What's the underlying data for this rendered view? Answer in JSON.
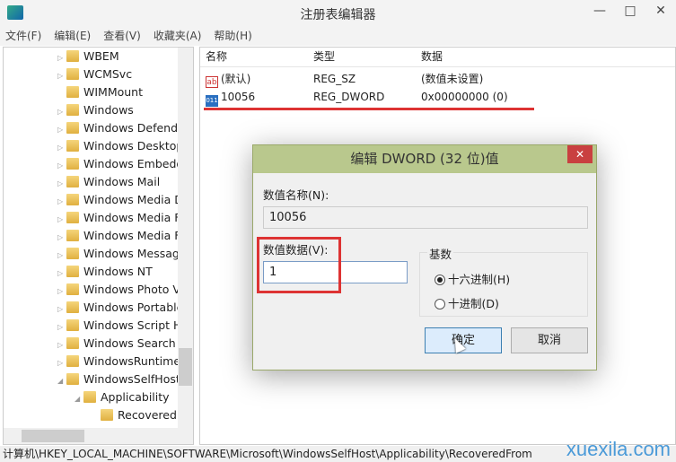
{
  "window": {
    "title": "注册表编辑器",
    "minimize": "—",
    "maximize": "□",
    "close": "✕"
  },
  "menu": [
    "文件(F)",
    "编辑(E)",
    "查看(V)",
    "收藏夹(A)",
    "帮助(H)"
  ],
  "tree": [
    {
      "label": "WBEM",
      "level": 0,
      "exp": "▷"
    },
    {
      "label": "WCMSvc",
      "level": 0,
      "exp": "▷"
    },
    {
      "label": "WIMMount",
      "level": 0,
      "exp": ""
    },
    {
      "label": "Windows",
      "level": 0,
      "exp": "▷"
    },
    {
      "label": "Windows Defende",
      "level": 0,
      "exp": "▷"
    },
    {
      "label": "Windows Desktop",
      "level": 0,
      "exp": "▷"
    },
    {
      "label": "Windows Embedd",
      "level": 0,
      "exp": "▷"
    },
    {
      "label": "Windows Mail",
      "level": 0,
      "exp": "▷"
    },
    {
      "label": "Windows Media D",
      "level": 0,
      "exp": "▷"
    },
    {
      "label": "Windows Media F",
      "level": 0,
      "exp": "▷"
    },
    {
      "label": "Windows Media F",
      "level": 0,
      "exp": "▷"
    },
    {
      "label": "Windows Messag",
      "level": 0,
      "exp": "▷"
    },
    {
      "label": "Windows NT",
      "level": 0,
      "exp": "▷"
    },
    {
      "label": "Windows Photo V",
      "level": 0,
      "exp": "▷"
    },
    {
      "label": "Windows Portable",
      "level": 0,
      "exp": "▷"
    },
    {
      "label": "Windows Script H",
      "level": 0,
      "exp": "▷"
    },
    {
      "label": "Windows Search",
      "level": 0,
      "exp": "▷"
    },
    {
      "label": "WindowsRuntime",
      "level": 0,
      "exp": "▷"
    },
    {
      "label": "WindowsSelfHost",
      "level": 0,
      "exp": "◢"
    },
    {
      "label": "Applicability",
      "level": 1,
      "exp": "◢"
    },
    {
      "label": "RecoveredI",
      "level": 2,
      "exp": ""
    }
  ],
  "list": {
    "columns": [
      "名称",
      "类型",
      "数据"
    ],
    "rows": [
      {
        "name": "(默认)",
        "type": "REG_SZ",
        "data": "(数值未设置)",
        "icon": "ab"
      },
      {
        "name": "10056",
        "type": "REG_DWORD",
        "data": "0x00000000 (0)",
        "icon": "011"
      }
    ]
  },
  "dialog": {
    "title": "编辑 DWORD (32 位)值",
    "close": "✕",
    "name_label": "数值名称(N):",
    "name_value": "10056",
    "data_label": "数值数据(V):",
    "data_value": "1",
    "base_label": "基数",
    "hex": "十六进制(H)",
    "dec": "十进制(D)",
    "hex_selected": true,
    "ok": "确定",
    "cancel": "取消"
  },
  "status": "计算机\\HKEY_LOCAL_MACHINE\\SOFTWARE\\Microsoft\\WindowsSelfHost\\Applicability\\RecoveredFrom",
  "watermark": "xuexila.com",
  "colors": {
    "dialog_title": "#b9c88d",
    "highlight": "#dd3333"
  }
}
